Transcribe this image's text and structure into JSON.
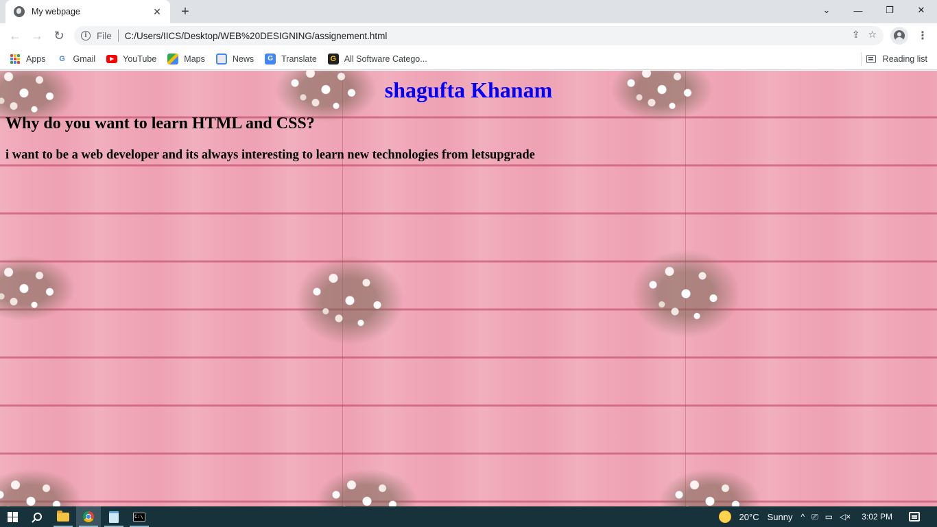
{
  "browser": {
    "tab": {
      "title": "My webpage",
      "favicon": "globe-icon",
      "close_glyph": "✕"
    },
    "new_tab_glyph": "+",
    "window_controls": {
      "dropdown": "⌄",
      "minimize": "—",
      "restore": "❐",
      "close": "✕"
    },
    "nav": {
      "back": "←",
      "forward": "→",
      "reload": "↻"
    },
    "omnibox": {
      "scheme_label": "File",
      "url": "C:/Users/IICS/Desktop/WEB%20DESIGNING/assignement.html",
      "share_icon": "⇪",
      "star_icon": "☆"
    },
    "menu_glyph": "⋮",
    "bookmarks": [
      {
        "label": "Apps",
        "icon": "apps-grid-icon"
      },
      {
        "label": "Gmail",
        "icon": "google-icon"
      },
      {
        "label": "YouTube",
        "icon": "youtube-icon"
      },
      {
        "label": "Maps",
        "icon": "maps-icon"
      },
      {
        "label": "News",
        "icon": "news-icon"
      },
      {
        "label": "Translate",
        "icon": "translate-icon"
      },
      {
        "label": "All Software Catego...",
        "icon": "g-logo-icon"
      }
    ],
    "reading_list": "Reading list"
  },
  "page": {
    "title": "shagufta Khanam",
    "question": "Why do you want to learn HTML and CSS?",
    "answer": "i want to be a web developer and its always interesting to learn new technologies from letsupgrade",
    "colors": {
      "title": "#0000ff",
      "text": "#000000",
      "background": "#f0a7b7"
    }
  },
  "taskbar": {
    "weather": {
      "temp": "20°C",
      "condition": "Sunny"
    },
    "time": "3:02 PM",
    "tray_chevron": "^"
  }
}
